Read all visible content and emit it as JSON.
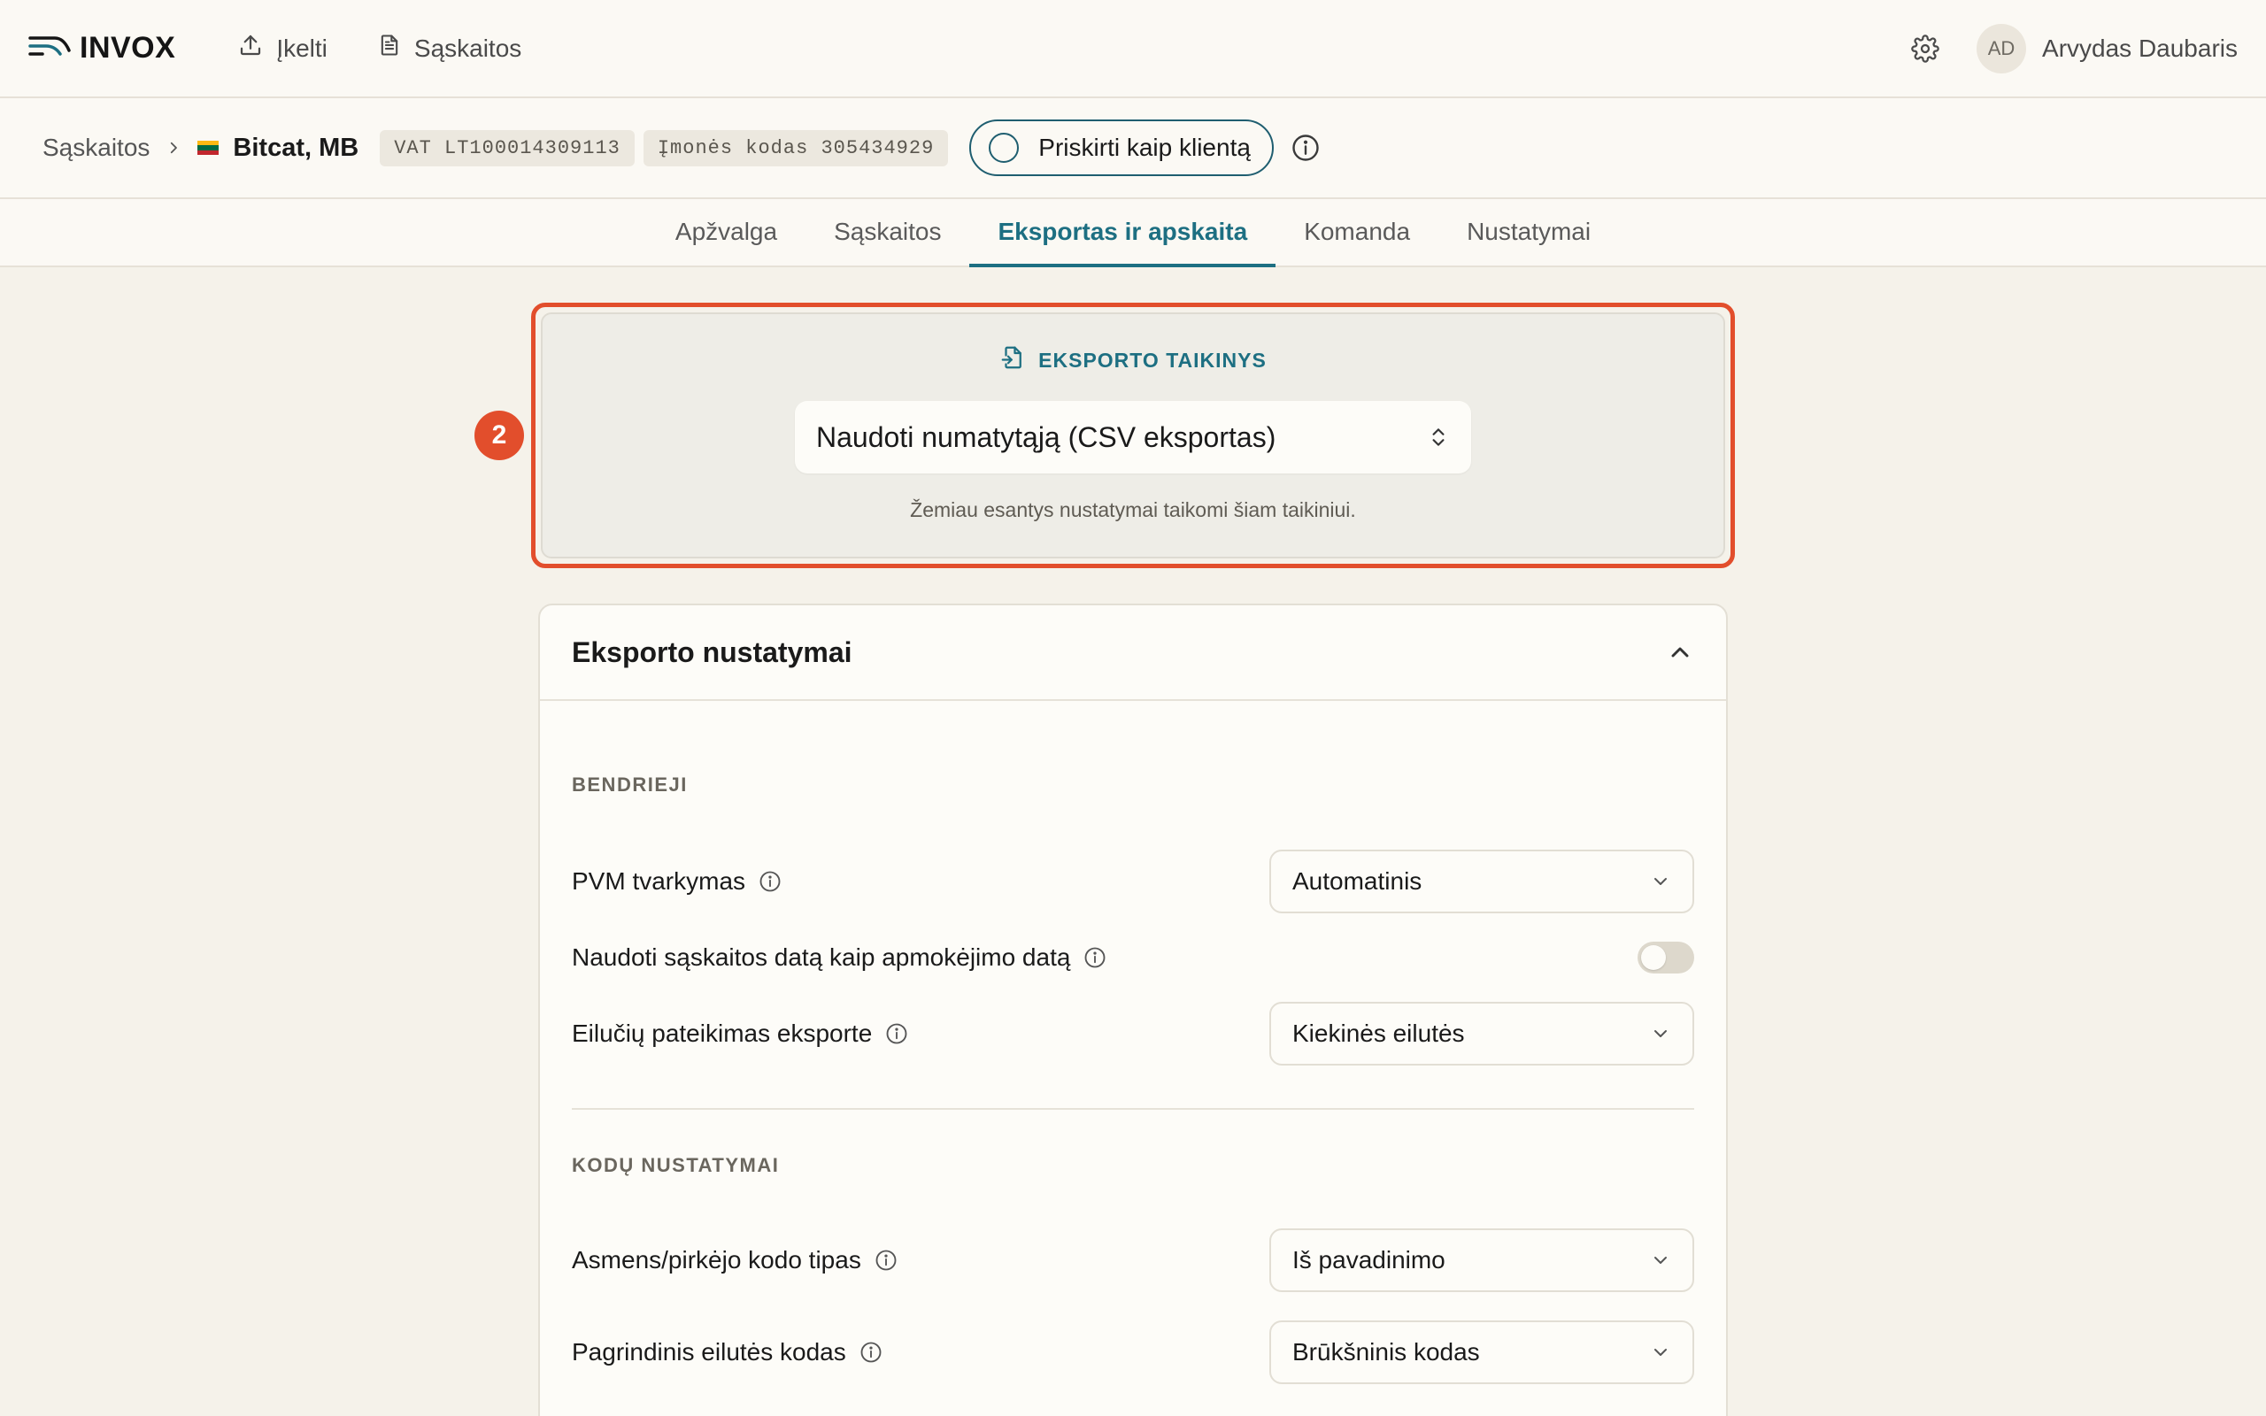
{
  "topbar": {
    "logo": "INVOX",
    "upload_label": "Įkelti",
    "invoices_label": "Sąskaitos",
    "user_initials": "AD",
    "user_name": "Arvydas Daubaris"
  },
  "breadcrumb": {
    "root": "Sąskaitos",
    "company": "Bitcat, MB",
    "vat_badge": "VAT LT100014309113",
    "code_badge": "Įmonės kodas 305434929",
    "assign_label": "Priskirti kaip klientą"
  },
  "tabs": [
    {
      "label": "Apžvalga",
      "active": false
    },
    {
      "label": "Sąskaitos",
      "active": false
    },
    {
      "label": "Eksportas ir apskaita",
      "active": true
    },
    {
      "label": "Komanda",
      "active": false
    },
    {
      "label": "Nustatymai",
      "active": false
    }
  ],
  "export_target": {
    "step": "2",
    "title": "EKSPORTO TAIKINYS",
    "selected": "Naudoti numatytąją (CSV eksportas)",
    "hint": "Žemiau esantys nustatymai taikomi šiam taikiniui."
  },
  "settings": {
    "title": "Eksporto nustatymai",
    "general": {
      "label": "BENDRIEJI",
      "vat_handling": {
        "label": "PVM tvarkymas",
        "value": "Automatinis"
      },
      "use_invoice_date": {
        "label": "Naudoti sąskaitos datą kaip apmokėjimo datą",
        "on": false
      },
      "line_presentation": {
        "label": "Eilučių pateikimas eksporte",
        "value": "Kiekinės eilutės"
      }
    },
    "codes": {
      "label": "KODŲ NUSTATYMAI",
      "buyer_code_type": {
        "label": "Asmens/pirkėjo kodo tipas",
        "value": "Iš pavadinimo"
      },
      "main_line_code": {
        "label": "Pagrindinis eilutės kodas",
        "value": "Brūkšninis kodas"
      }
    }
  },
  "colors": {
    "accent": "#1d6f82",
    "highlight": "#e24e2c",
    "background": "#f5f2ea"
  }
}
